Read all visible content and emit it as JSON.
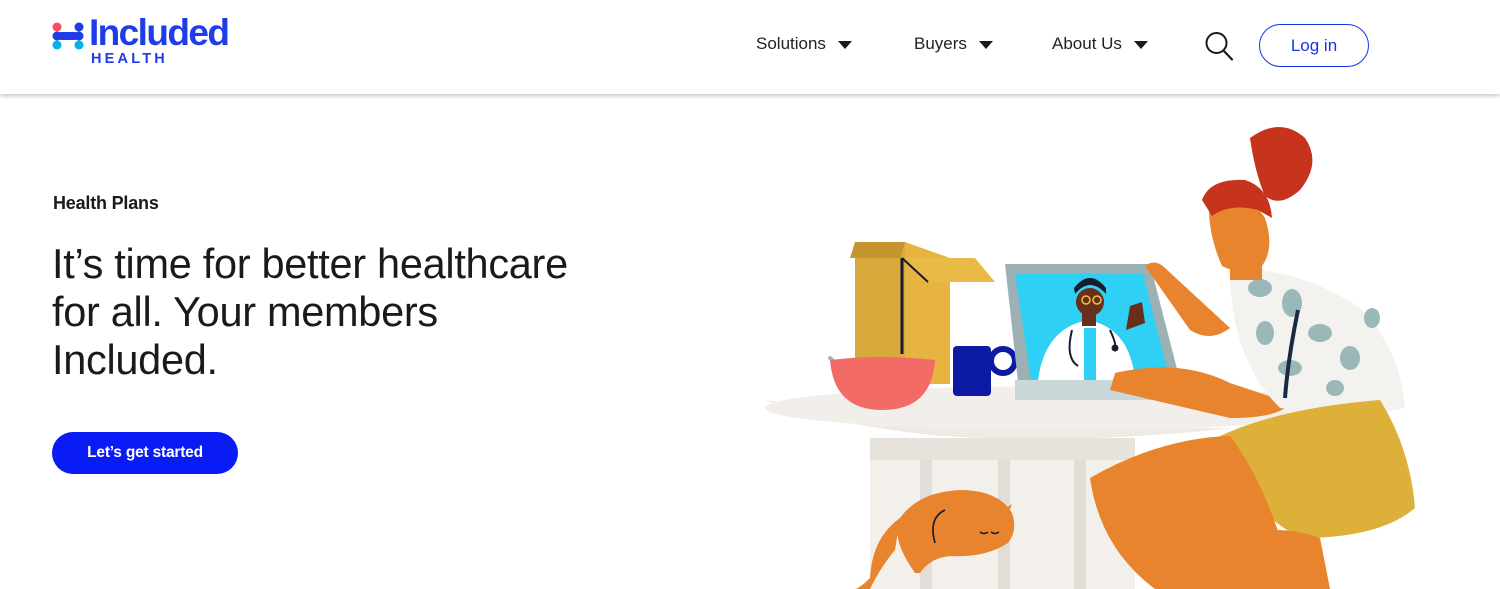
{
  "brand": {
    "name": "Included",
    "sub": "HEALTH",
    "primary_color": "#1e3ce8",
    "accent_color": "#00b4e6"
  },
  "nav": {
    "items": [
      {
        "label": "Solutions",
        "icon": "chevron-down-icon"
      },
      {
        "label": "Buyers",
        "icon": "chevron-down-icon"
      },
      {
        "label": "About Us",
        "icon": "chevron-down-icon"
      }
    ],
    "search_icon": "search-icon",
    "login_label": "Log in"
  },
  "hero": {
    "eyebrow": "Health Plans",
    "headline": "It’s time for better healthcare for all. Your members Included.",
    "cta_label": "Let’s get started",
    "cta_color": "#0a1cf5"
  },
  "illustration": {
    "name": "telehealth-video-call-illustration"
  }
}
